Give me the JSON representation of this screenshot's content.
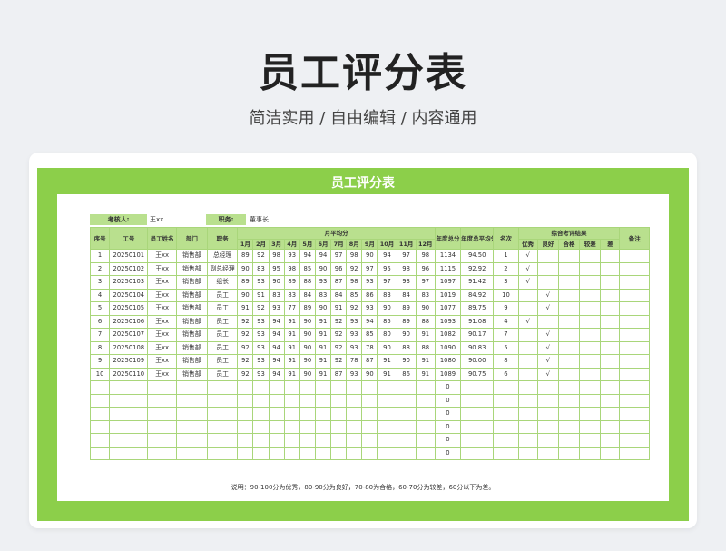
{
  "page": {
    "title": "员工评分表",
    "subtitle": "简洁实用 / 自由编辑 / 内容通用"
  },
  "sheet": {
    "title": "员工评分表",
    "assessor_label": "考核人:",
    "assessor_value": "王xx",
    "position_label": "职务:",
    "position_value": "董事长",
    "note": "说明：90-100分为优秀，80-90分为良好，70-80为合格，60-70分为较差，60分以下为差。"
  },
  "headers": {
    "seq": "序号",
    "id": "工号",
    "name": "员工姓名",
    "dept": "部门",
    "role": "职务",
    "monthly_group": "月平均分",
    "months": [
      "1月",
      "2月",
      "3月",
      "4月",
      "5月",
      "6月",
      "7月",
      "8月",
      "9月",
      "10月",
      "11月",
      "12月"
    ],
    "annual_total": "年度总分",
    "annual_avg": "年度总平均分",
    "rank": "名次",
    "result_group": "综合考评结果",
    "results": [
      "优秀",
      "良好",
      "合格",
      "较差",
      "差"
    ],
    "remark": "备注"
  },
  "rows": [
    {
      "seq": "1",
      "id": "20250101",
      "name": "王xx",
      "dept": "销售部",
      "role": "总经理",
      "scores": [
        "89",
        "92",
        "98",
        "93",
        "94",
        "94",
        "97",
        "98",
        "90",
        "94",
        "97",
        "98"
      ],
      "total": "1134",
      "avg": "94.50",
      "rank": "1",
      "results": [
        "√",
        "",
        "",
        "",
        ""
      ],
      "remark": ""
    },
    {
      "seq": "2",
      "id": "20250102",
      "name": "王xx",
      "dept": "销售部",
      "role": "副总经理",
      "scores": [
        "90",
        "83",
        "95",
        "98",
        "85",
        "90",
        "96",
        "92",
        "97",
        "95",
        "98",
        "96"
      ],
      "total": "1115",
      "avg": "92.92",
      "rank": "2",
      "results": [
        "√",
        "",
        "",
        "",
        ""
      ],
      "remark": ""
    },
    {
      "seq": "3",
      "id": "20250103",
      "name": "王xx",
      "dept": "销售部",
      "role": "组长",
      "scores": [
        "89",
        "93",
        "90",
        "89",
        "88",
        "93",
        "87",
        "98",
        "93",
        "97",
        "93",
        "97"
      ],
      "total": "1097",
      "avg": "91.42",
      "rank": "3",
      "results": [
        "√",
        "",
        "",
        "",
        ""
      ],
      "remark": ""
    },
    {
      "seq": "4",
      "id": "20250104",
      "name": "王xx",
      "dept": "销售部",
      "role": "员工",
      "scores": [
        "90",
        "91",
        "83",
        "83",
        "84",
        "83",
        "84",
        "85",
        "86",
        "83",
        "84",
        "83"
      ],
      "total": "1019",
      "avg": "84.92",
      "rank": "10",
      "results": [
        "",
        "√",
        "",
        "",
        ""
      ],
      "remark": ""
    },
    {
      "seq": "5",
      "id": "20250105",
      "name": "王xx",
      "dept": "销售部",
      "role": "员工",
      "scores": [
        "91",
        "92",
        "93",
        "77",
        "89",
        "90",
        "91",
        "92",
        "93",
        "90",
        "89",
        "90"
      ],
      "total": "1077",
      "avg": "89.75",
      "rank": "9",
      "results": [
        "",
        "√",
        "",
        "",
        ""
      ],
      "remark": ""
    },
    {
      "seq": "6",
      "id": "20250106",
      "name": "王xx",
      "dept": "销售部",
      "role": "员工",
      "scores": [
        "92",
        "93",
        "94",
        "91",
        "90",
        "91",
        "92",
        "93",
        "94",
        "85",
        "89",
        "88"
      ],
      "total": "1093",
      "avg": "91.08",
      "rank": "4",
      "results": [
        "√",
        "",
        "",
        "",
        ""
      ],
      "remark": ""
    },
    {
      "seq": "7",
      "id": "20250107",
      "name": "王xx",
      "dept": "销售部",
      "role": "员工",
      "scores": [
        "92",
        "93",
        "94",
        "91",
        "90",
        "91",
        "92",
        "93",
        "85",
        "80",
        "90",
        "91"
      ],
      "total": "1082",
      "avg": "90.17",
      "rank": "7",
      "results": [
        "",
        "√",
        "",
        "",
        ""
      ],
      "remark": ""
    },
    {
      "seq": "8",
      "id": "20250108",
      "name": "王xx",
      "dept": "销售部",
      "role": "员工",
      "scores": [
        "92",
        "93",
        "94",
        "91",
        "90",
        "91",
        "92",
        "93",
        "78",
        "90",
        "88",
        "88"
      ],
      "total": "1090",
      "avg": "90.83",
      "rank": "5",
      "results": [
        "",
        "√",
        "",
        "",
        ""
      ],
      "remark": ""
    },
    {
      "seq": "9",
      "id": "20250109",
      "name": "王xx",
      "dept": "销售部",
      "role": "员工",
      "scores": [
        "92",
        "93",
        "94",
        "91",
        "90",
        "91",
        "92",
        "78",
        "87",
        "91",
        "90",
        "91"
      ],
      "total": "1080",
      "avg": "90.00",
      "rank": "8",
      "results": [
        "",
        "√",
        "",
        "",
        ""
      ],
      "remark": ""
    },
    {
      "seq": "10",
      "id": "20250110",
      "name": "王xx",
      "dept": "销售部",
      "role": "员工",
      "scores": [
        "92",
        "93",
        "94",
        "91",
        "90",
        "91",
        "87",
        "93",
        "90",
        "91",
        "86",
        "91"
      ],
      "total": "1089",
      "avg": "90.75",
      "rank": "6",
      "results": [
        "",
        "√",
        "",
        "",
        ""
      ],
      "remark": ""
    }
  ],
  "empty_row_totals": [
    "0",
    "0",
    "0",
    "0",
    "0",
    "0"
  ],
  "colors": {
    "accent": "#8ccf4a",
    "header_fill": "#b9e08e",
    "grid_line": "#a9d67a"
  }
}
